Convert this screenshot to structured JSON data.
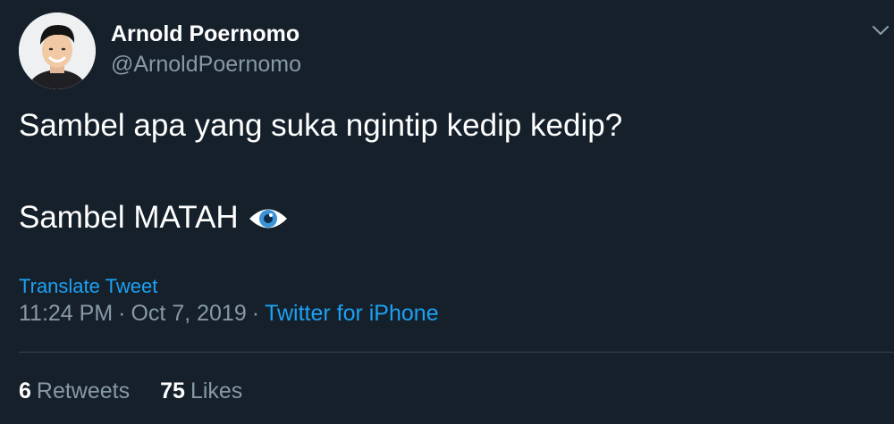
{
  "author": {
    "display_name": "Arnold Poernomo",
    "handle": "@ArnoldPoernomo"
  },
  "tweet": {
    "line1": "Sambel apa yang suka ngintip kedip kedip?",
    "line2": "Sambel MATAH",
    "emoji_icon": "eye-icon"
  },
  "translate_label": "Translate Tweet",
  "meta": {
    "time": "11:24 PM",
    "separator": "·",
    "date": "Oct 7, 2019",
    "source": "Twitter for iPhone"
  },
  "stats": {
    "retweets_count": "6",
    "retweets_label": "Retweets",
    "likes_count": "75",
    "likes_label": "Likes"
  },
  "colors": {
    "background": "#15202b",
    "text_primary": "#ffffff",
    "text_secondary": "#8899a6",
    "link": "#1da1f2",
    "divider": "#38444d"
  }
}
